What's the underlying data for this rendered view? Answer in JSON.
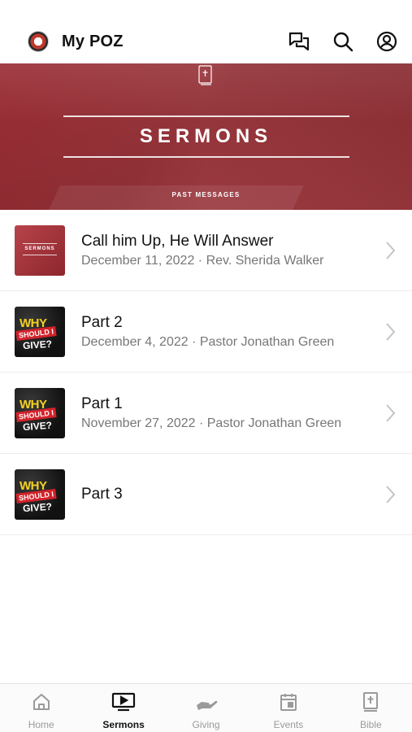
{
  "header": {
    "title": "My POZ"
  },
  "banner": {
    "title": "SERMONS",
    "subtitle": "PAST MESSAGES"
  },
  "thumbnails": {
    "red_label": "SERMONS",
    "why": "WHY",
    "should": "SHOULD I",
    "give": "GIVE?"
  },
  "sermons": [
    {
      "title": "Call him Up, He Will Answer",
      "meta": "December 11, 2022 · Rev. Sherida Walker",
      "thumb": "sermons-red"
    },
    {
      "title": "Part 2",
      "meta": "December 4, 2022 · Pastor Jonathan Green",
      "thumb": "why-should-i-give"
    },
    {
      "title": "Part 1",
      "meta": "November 27, 2022 · Pastor Jonathan Green",
      "thumb": "why-should-i-give"
    },
    {
      "title": "Part 3",
      "meta": "",
      "thumb": "why-should-i-give"
    }
  ],
  "tabs": [
    {
      "label": "Home",
      "icon": "home-icon",
      "active": false
    },
    {
      "label": "Sermons",
      "icon": "tv-play-icon",
      "active": true
    },
    {
      "label": "Giving",
      "icon": "giving-hand-icon",
      "active": false
    },
    {
      "label": "Events",
      "icon": "calendar-icon",
      "active": false
    },
    {
      "label": "Bible",
      "icon": "bible-icon",
      "active": false
    }
  ],
  "colors": {
    "banner": "#9b2f36",
    "active_tab": "#111111",
    "inactive_tab": "#9a9a9a"
  }
}
